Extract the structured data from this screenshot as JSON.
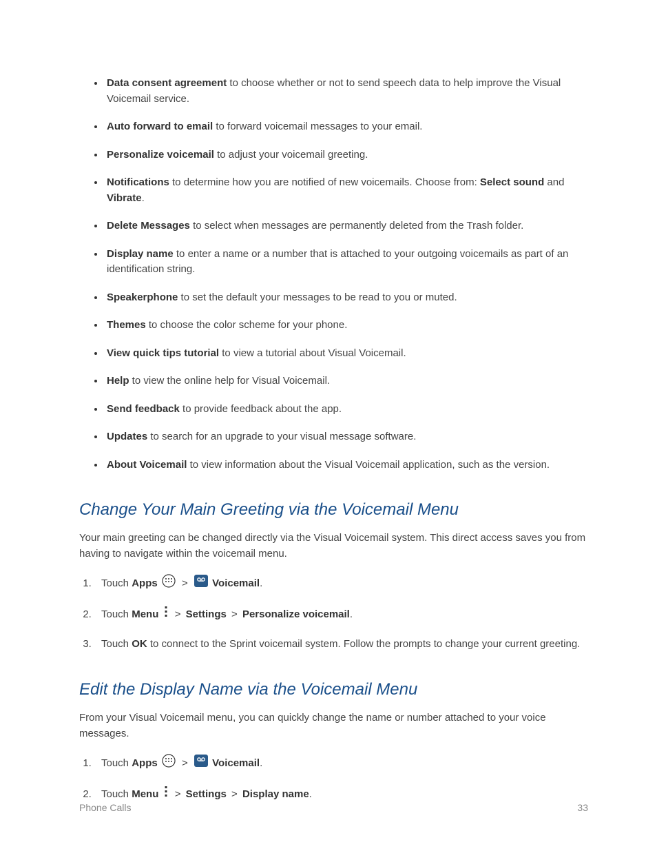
{
  "settings_list": [
    {
      "bold": "Data consent agreement",
      "text": " to choose whether or not to send speech data to help improve the Visual Voicemail service."
    },
    {
      "bold": "Auto forward to email",
      "text": " to forward voicemail messages to your email."
    },
    {
      "bold": "Personalize voicemail",
      "text": " to adjust your voicemail greeting."
    },
    {
      "bold": "Notifications",
      "text": " to determine how you are notified of new voicemails. Choose from: ",
      "bold2": "Select sound",
      "mid": " and ",
      "bold3": "Vibrate",
      "tail": "."
    },
    {
      "bold": "Delete Messages",
      "text": " to select when messages are permanently deleted from the Trash folder."
    },
    {
      "bold": "Display name",
      "text": " to enter a name or a number that is attached to your outgoing voicemails as part of an identification string."
    },
    {
      "bold": "Speakerphone",
      "text": " to set the default your messages to be read to you or muted."
    },
    {
      "bold": "Themes",
      "text": " to choose the color scheme for your phone."
    },
    {
      "bold": "View quick tips tutorial",
      "text": " to view a tutorial about Visual Voicemail."
    },
    {
      "bold": "Help",
      "text": " to view the online help for Visual Voicemail."
    },
    {
      "bold": "Send feedback",
      "text": " to provide feedback about the app."
    },
    {
      "bold": "Updates",
      "text": " to search for an upgrade to your visual message software."
    },
    {
      "bold": "About Voicemail",
      "text": " to view information about the Visual Voicemail application, such as the version."
    }
  ],
  "section1": {
    "heading": "Change Your Main Greeting via the Voicemail Menu",
    "intro": "Your main greeting can be changed directly via the Visual Voicemail system. This direct access saves you from having to navigate within the voicemail menu.",
    "steps": {
      "s1_touch": "Touch ",
      "s1_apps": "Apps",
      "s1_chev": " > ",
      "s1_voicemail": " Voicemail",
      "s1_period": ".",
      "s2_touch": "Touch ",
      "s2_menu": "Menu",
      "s2_chev1": " > ",
      "s2_settings": "Settings ",
      "s2_chev2": " > ",
      "s2_personalize": "Personalize voicemail",
      "s2_period": ".",
      "s3_touch": "Touch ",
      "s3_ok": "OK",
      "s3_tail": " to connect to the Sprint voicemail system. Follow the prompts to change your current greeting."
    }
  },
  "section2": {
    "heading": "Edit the Display Name via the Voicemail Menu",
    "intro": "From your Visual Voicemail menu, you can quickly change the name or number attached to your voice messages.",
    "steps": {
      "s1_touch": "Touch ",
      "s1_apps": "Apps",
      "s1_chev": " > ",
      "s1_voicemail": " Voicemail",
      "s1_period": ".",
      "s2_touch": "Touch ",
      "s2_menu": "Menu",
      "s2_chev1": " > ",
      "s2_settings": "Settings",
      "s2_chev2": " > ",
      "s2_display": "Display name",
      "s2_period": "."
    }
  },
  "footer": {
    "left": "Phone Calls",
    "right": "33"
  }
}
